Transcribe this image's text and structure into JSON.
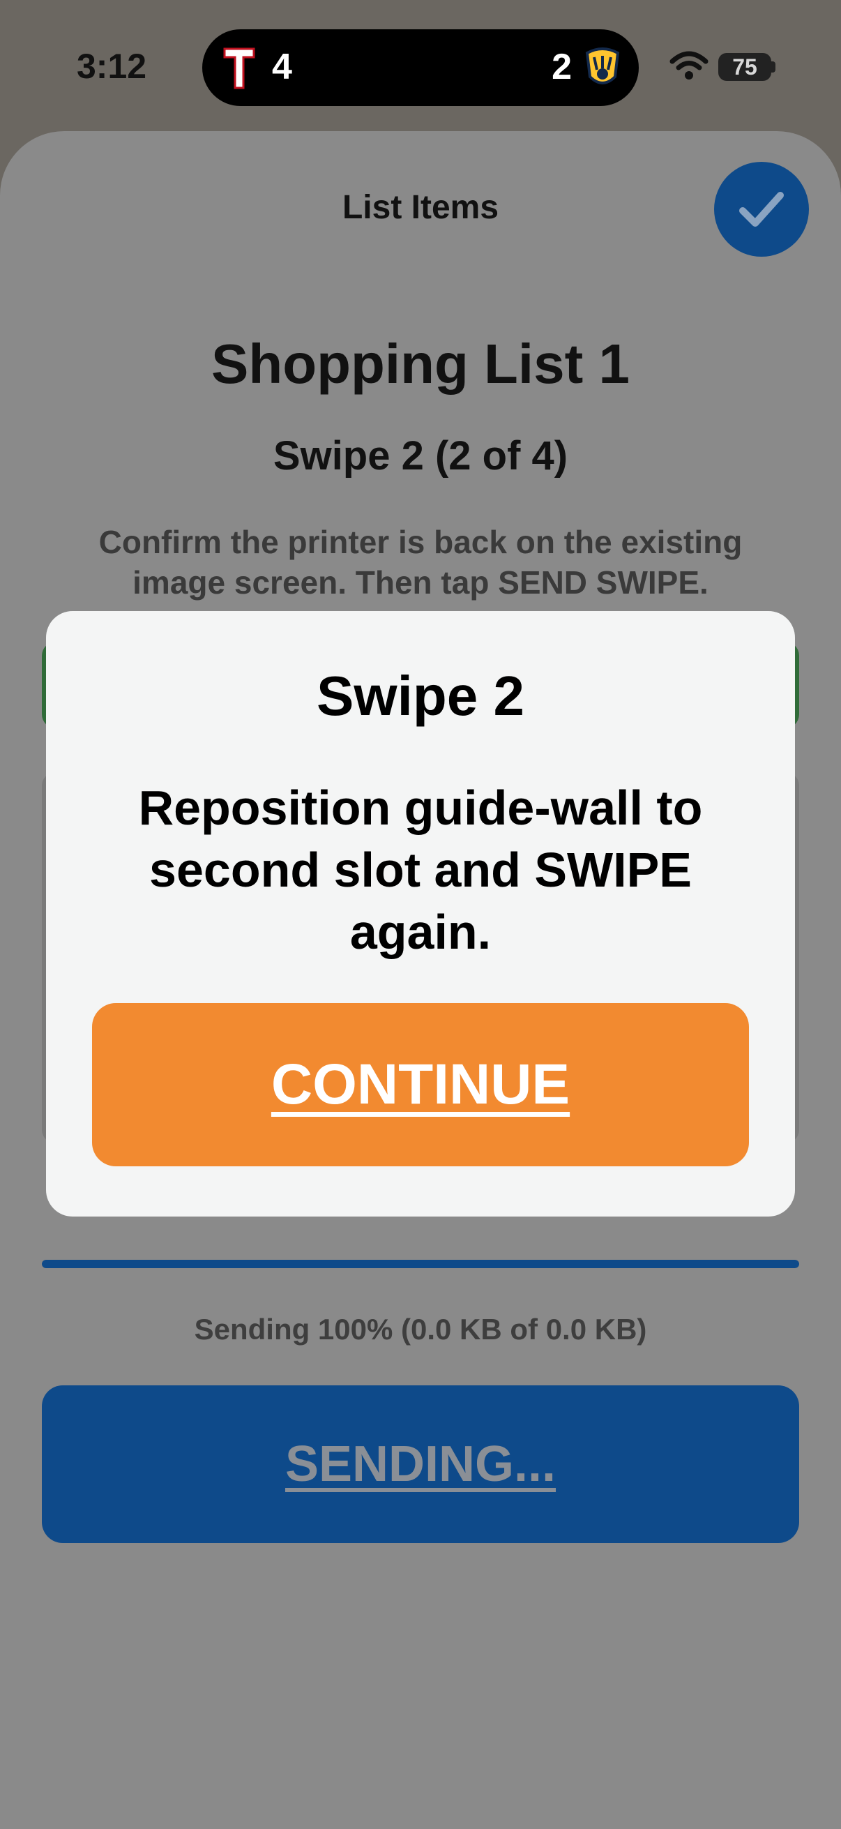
{
  "status_bar": {
    "time": "3:12",
    "live_activity": {
      "left_score": "4",
      "right_score": "2"
    },
    "battery_level": "75"
  },
  "sheet": {
    "title": "List Items",
    "list_name": "Shopping List 1",
    "swipe_step": "Swipe 2 (2 of 4)",
    "instruction": "Confirm the printer is back on the existing image screen. Then tap SEND SWIPE.",
    "progress": {
      "fraction": 1.0,
      "text": "Sending 100% (0.0 KB of 0.0 KB)"
    },
    "sending_button_label": "SENDING..."
  },
  "modal": {
    "title": "Swipe 2",
    "body": "Reposition guide-wall to second slot and SWIPE again.",
    "continue_label": "CONTINUE"
  },
  "colors": {
    "accent_blue": "#0e4a8a",
    "continue_orange": "#f28a30",
    "overlay_gray": "#8a8a8a"
  },
  "icons": [
    "rangers-logo-icon",
    "brewers-logo-icon",
    "wifi-icon",
    "battery-icon",
    "checkmark-icon"
  ]
}
